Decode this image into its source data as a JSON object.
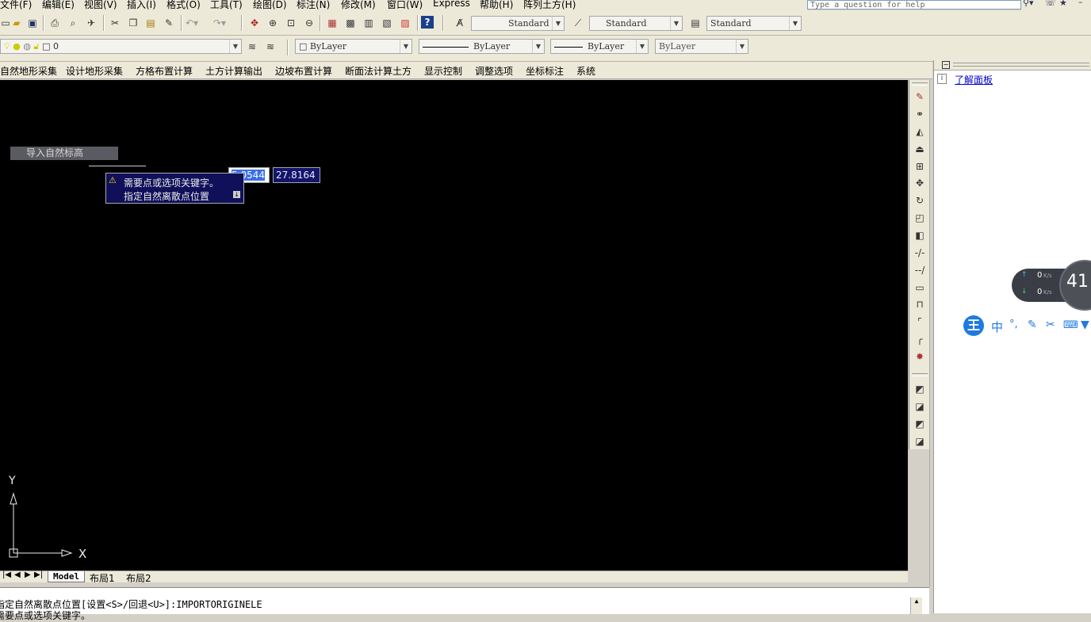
{
  "menu": [
    "文件(F)",
    "编辑(E)",
    "视图(V)",
    "插入(I)",
    "格式(O)",
    "工具(T)",
    "绘图(D)",
    "标注(N)",
    "修改(M)",
    "窗口(W)",
    "Express",
    "帮助(H)",
    "阵列土方(H)"
  ],
  "help_search": {
    "placeholder": "Type a question for help"
  },
  "toolbar_styles": {
    "text_style": "Standard",
    "dim_style": "Standard",
    "table_style": "Standard"
  },
  "layer": {
    "current": "0"
  },
  "properties": {
    "color": "ByLayer",
    "linetype": "ByLayer",
    "lineweight": "ByLayer",
    "plotstyle": "ByLayer"
  },
  "cad_menu": [
    "自然地形采集",
    "设计地形采集",
    "方格布置计算",
    "土方计算输出",
    "边坡布置计算",
    "断面法计算土方",
    "显示控制",
    "调整选项",
    "坐标标注",
    "系统"
  ],
  "canvas": {
    "command_label": "导入自然标高",
    "tooltip_line1": "需要点或选项关键字。",
    "tooltip_line2": "指定自然离散点位置",
    "input_x": "5.0544",
    "input_y": "27.8164",
    "ucs_x": "X",
    "ucs_y": "Y"
  },
  "layout_tabs": [
    "Model",
    "布局1",
    "布局2"
  ],
  "right_panel": {
    "link": "了解面板"
  },
  "net_widget": {
    "up": "0",
    "down": "0",
    "unit": "K/s",
    "percent": "41"
  },
  "ime_bar": {
    "logo": "王",
    "mode": "中",
    "punct": "°,"
  },
  "command_history": [
    "指定自然离散点位置[设置<S>/回退<U>]:IMPORTORIGINELE",
    "需要点或选项关键字。"
  ],
  "colors": {
    "canvas_bg": "#000000",
    "tooltip_bg": "#10105a",
    "highlight": "#3a6ee8",
    "link": "#0000cc"
  }
}
